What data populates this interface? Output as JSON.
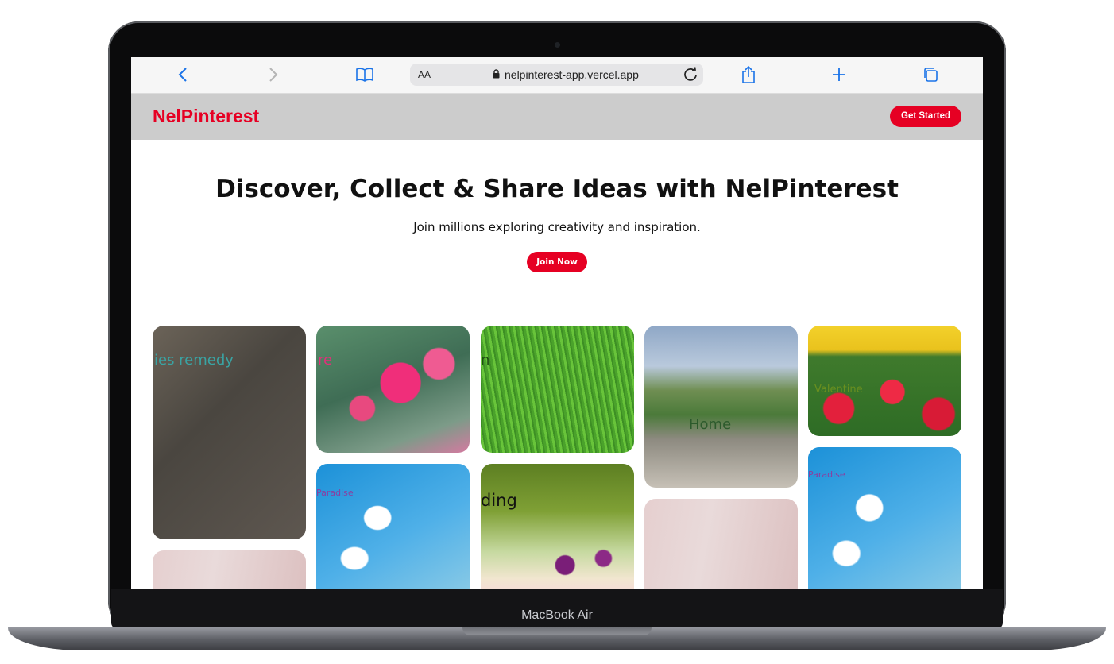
{
  "device": {
    "label": "MacBook Air"
  },
  "browser": {
    "text_size_label": "AA",
    "url": "nelpinterest-app.vercel.app",
    "icons": [
      "back-icon",
      "forward-icon",
      "bookmarks-icon",
      "lock-icon",
      "reload-icon",
      "share-icon",
      "new-tab-icon",
      "tabs-icon"
    ]
  },
  "nav": {
    "logo": "NelPinterest",
    "cta_label": "Get Started"
  },
  "hero": {
    "title": "Discover, Collect & Share Ideas with NelPinterest",
    "subtitle": "Join millions exploring creativity and inspiration.",
    "cta_label": "Join Now"
  },
  "pins": {
    "veggies": "ies remedy",
    "flowers": "re",
    "grass": "n",
    "house": "Home",
    "tulips": "Valentine",
    "sky1": "Paradise",
    "garden": "ding",
    "sky2": "Paradise"
  },
  "colors": {
    "brand": "#e60023",
    "nav_bg": "#cccccc"
  }
}
